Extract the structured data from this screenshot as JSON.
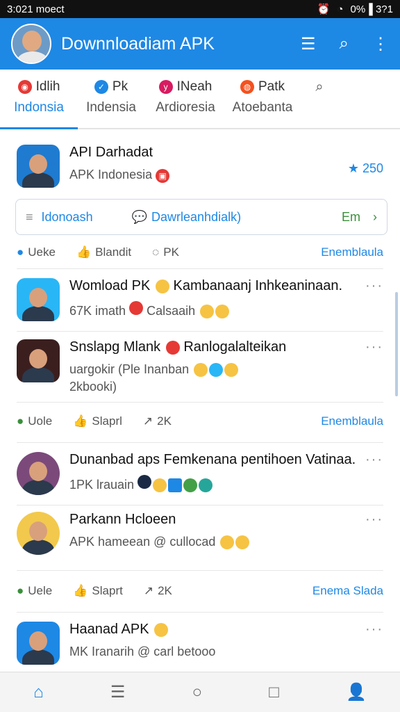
{
  "status": {
    "time": "3:021 moect",
    "right": "0%▐ 3?1"
  },
  "appbar": {
    "title": "Downnloadiam APK"
  },
  "tabs": [
    {
      "top": "Idlih",
      "bottom": "Indonsia",
      "active": true
    },
    {
      "top": "Pk",
      "bottom": "Indensia"
    },
    {
      "top": "INeah",
      "bottom": "Ardioresia"
    },
    {
      "top": "Patk",
      "bottom": "Atoebanta"
    }
  ],
  "featured": {
    "name": "API Darhadat",
    "sub": "APK Indonesia",
    "rating": "250"
  },
  "pillbar": {
    "item1": "Idonoash",
    "item2": "Dawrleanhdialk)",
    "item3": "Em"
  },
  "actions1": {
    "a": "Ueke",
    "b": "Blandit",
    "c": "PK",
    "link": "Enemblaula"
  },
  "items": [
    {
      "name": "Womload PK",
      "title2": "Kambanaanj Inhkeaninaan.",
      "sub": "67K imath",
      "sub2": "Calsaaih"
    },
    {
      "name": "Snslapg Mlank",
      "title2": "Ranlogalalteikan",
      "sub": "uargokir (Ple Inanban",
      "sub2": "2kbooki)"
    },
    {
      "name": "Dunanbad aps",
      "title2": "Femkenana pentihoen Vatinaa.",
      "sub": "1PK lrauain"
    },
    {
      "name": "Parkann Hcloeen",
      "sub": "APK hameean @ cullocad"
    },
    {
      "name": "Haanad APK",
      "sub": "MK Iranarih @ carl betooo"
    }
  ],
  "actions2": {
    "a": "Uole",
    "b": "Slaprl",
    "c": "2K",
    "link": "Enemblaula"
  },
  "actions3": {
    "a": "Uele",
    "b": "Slaprt",
    "c": "2K",
    "link": "Enema Slada"
  }
}
